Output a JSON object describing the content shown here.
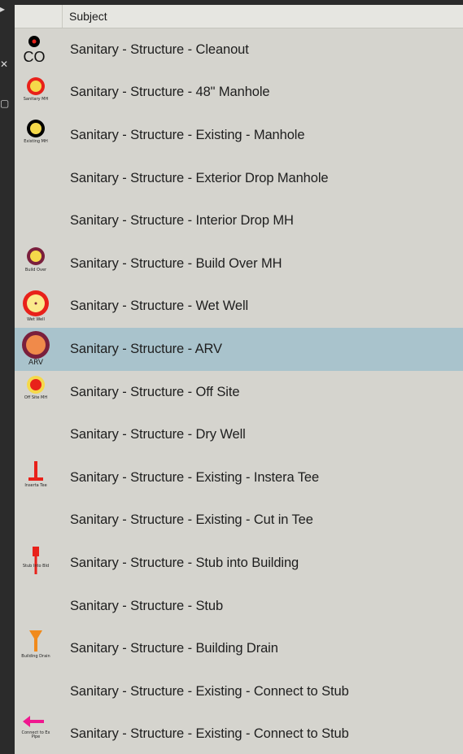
{
  "left_strip": {
    "glyphs": [
      "▸",
      "✕",
      "▢"
    ]
  },
  "header": {
    "subject_label": "Subject"
  },
  "rows": [
    {
      "subject": "Sanitary - Structure -  Cleanout",
      "icon": "cleanout-icon",
      "icon_label": "CO"
    },
    {
      "subject": "Sanitary - Structure - 48\" Manhole",
      "icon": "manhole-48-icon",
      "icon_label": "Sanitary MH"
    },
    {
      "subject": "Sanitary - Structure - Existing - Manhole",
      "icon": "existing-manhole-icon",
      "icon_label": "Existing MH"
    },
    {
      "subject": "Sanitary - Structure - Exterior Drop Manhole",
      "icon": ""
    },
    {
      "subject": "Sanitary - Structure - Interior Drop MH",
      "icon": ""
    },
    {
      "subject": "Sanitary - Structure - Build Over MH",
      "icon": "build-over-icon",
      "icon_label": "Build Over"
    },
    {
      "subject": "Sanitary - Structure - Wet Well",
      "icon": "wet-well-icon",
      "icon_label": "Wet Well"
    },
    {
      "subject": "Sanitary - Structure - ARV",
      "icon": "arv-icon",
      "icon_label": "ARV",
      "selected": true
    },
    {
      "subject": "Sanitary - Structure - Off Site",
      "icon": "off-site-icon",
      "icon_label": "Off Site MH"
    },
    {
      "subject": "Sanitary - Structure - Dry Well",
      "icon": ""
    },
    {
      "subject": "Sanitary - Structure - Existing - Instera Tee",
      "icon": "insertion-tee-icon",
      "icon_label": "Inserta Tee"
    },
    {
      "subject": "Sanitary - Structure - Existing - Cut in Tee",
      "icon": ""
    },
    {
      "subject": "Sanitary - Structure - Stub into Building",
      "icon": "stub-into-building-icon",
      "icon_label": "Stub Into Bld"
    },
    {
      "subject": "Sanitary - Structure - Stub",
      "icon": ""
    },
    {
      "subject": "Sanitary - Structure - Building Drain",
      "icon": "building-drain-icon",
      "icon_label": "Building Drain"
    },
    {
      "subject": "Sanitary - Structure - Existing - Connect to Stub",
      "icon": ""
    },
    {
      "subject": "Sanitary - Structure - Existing - Connect to Stub",
      "icon": "connect-arrow-icon",
      "icon_label": "Connect to Ex Pipe"
    }
  ],
  "colors": {
    "selected_row": "#a9c3cc",
    "panel_bg": "#d5d4ce",
    "header_bg": "#e6e6e1",
    "red": "#e8211a",
    "yellow": "#f5d94a",
    "maroon": "#7a1f3c",
    "magenta": "#f0178f",
    "orange": "#f08a1c"
  }
}
